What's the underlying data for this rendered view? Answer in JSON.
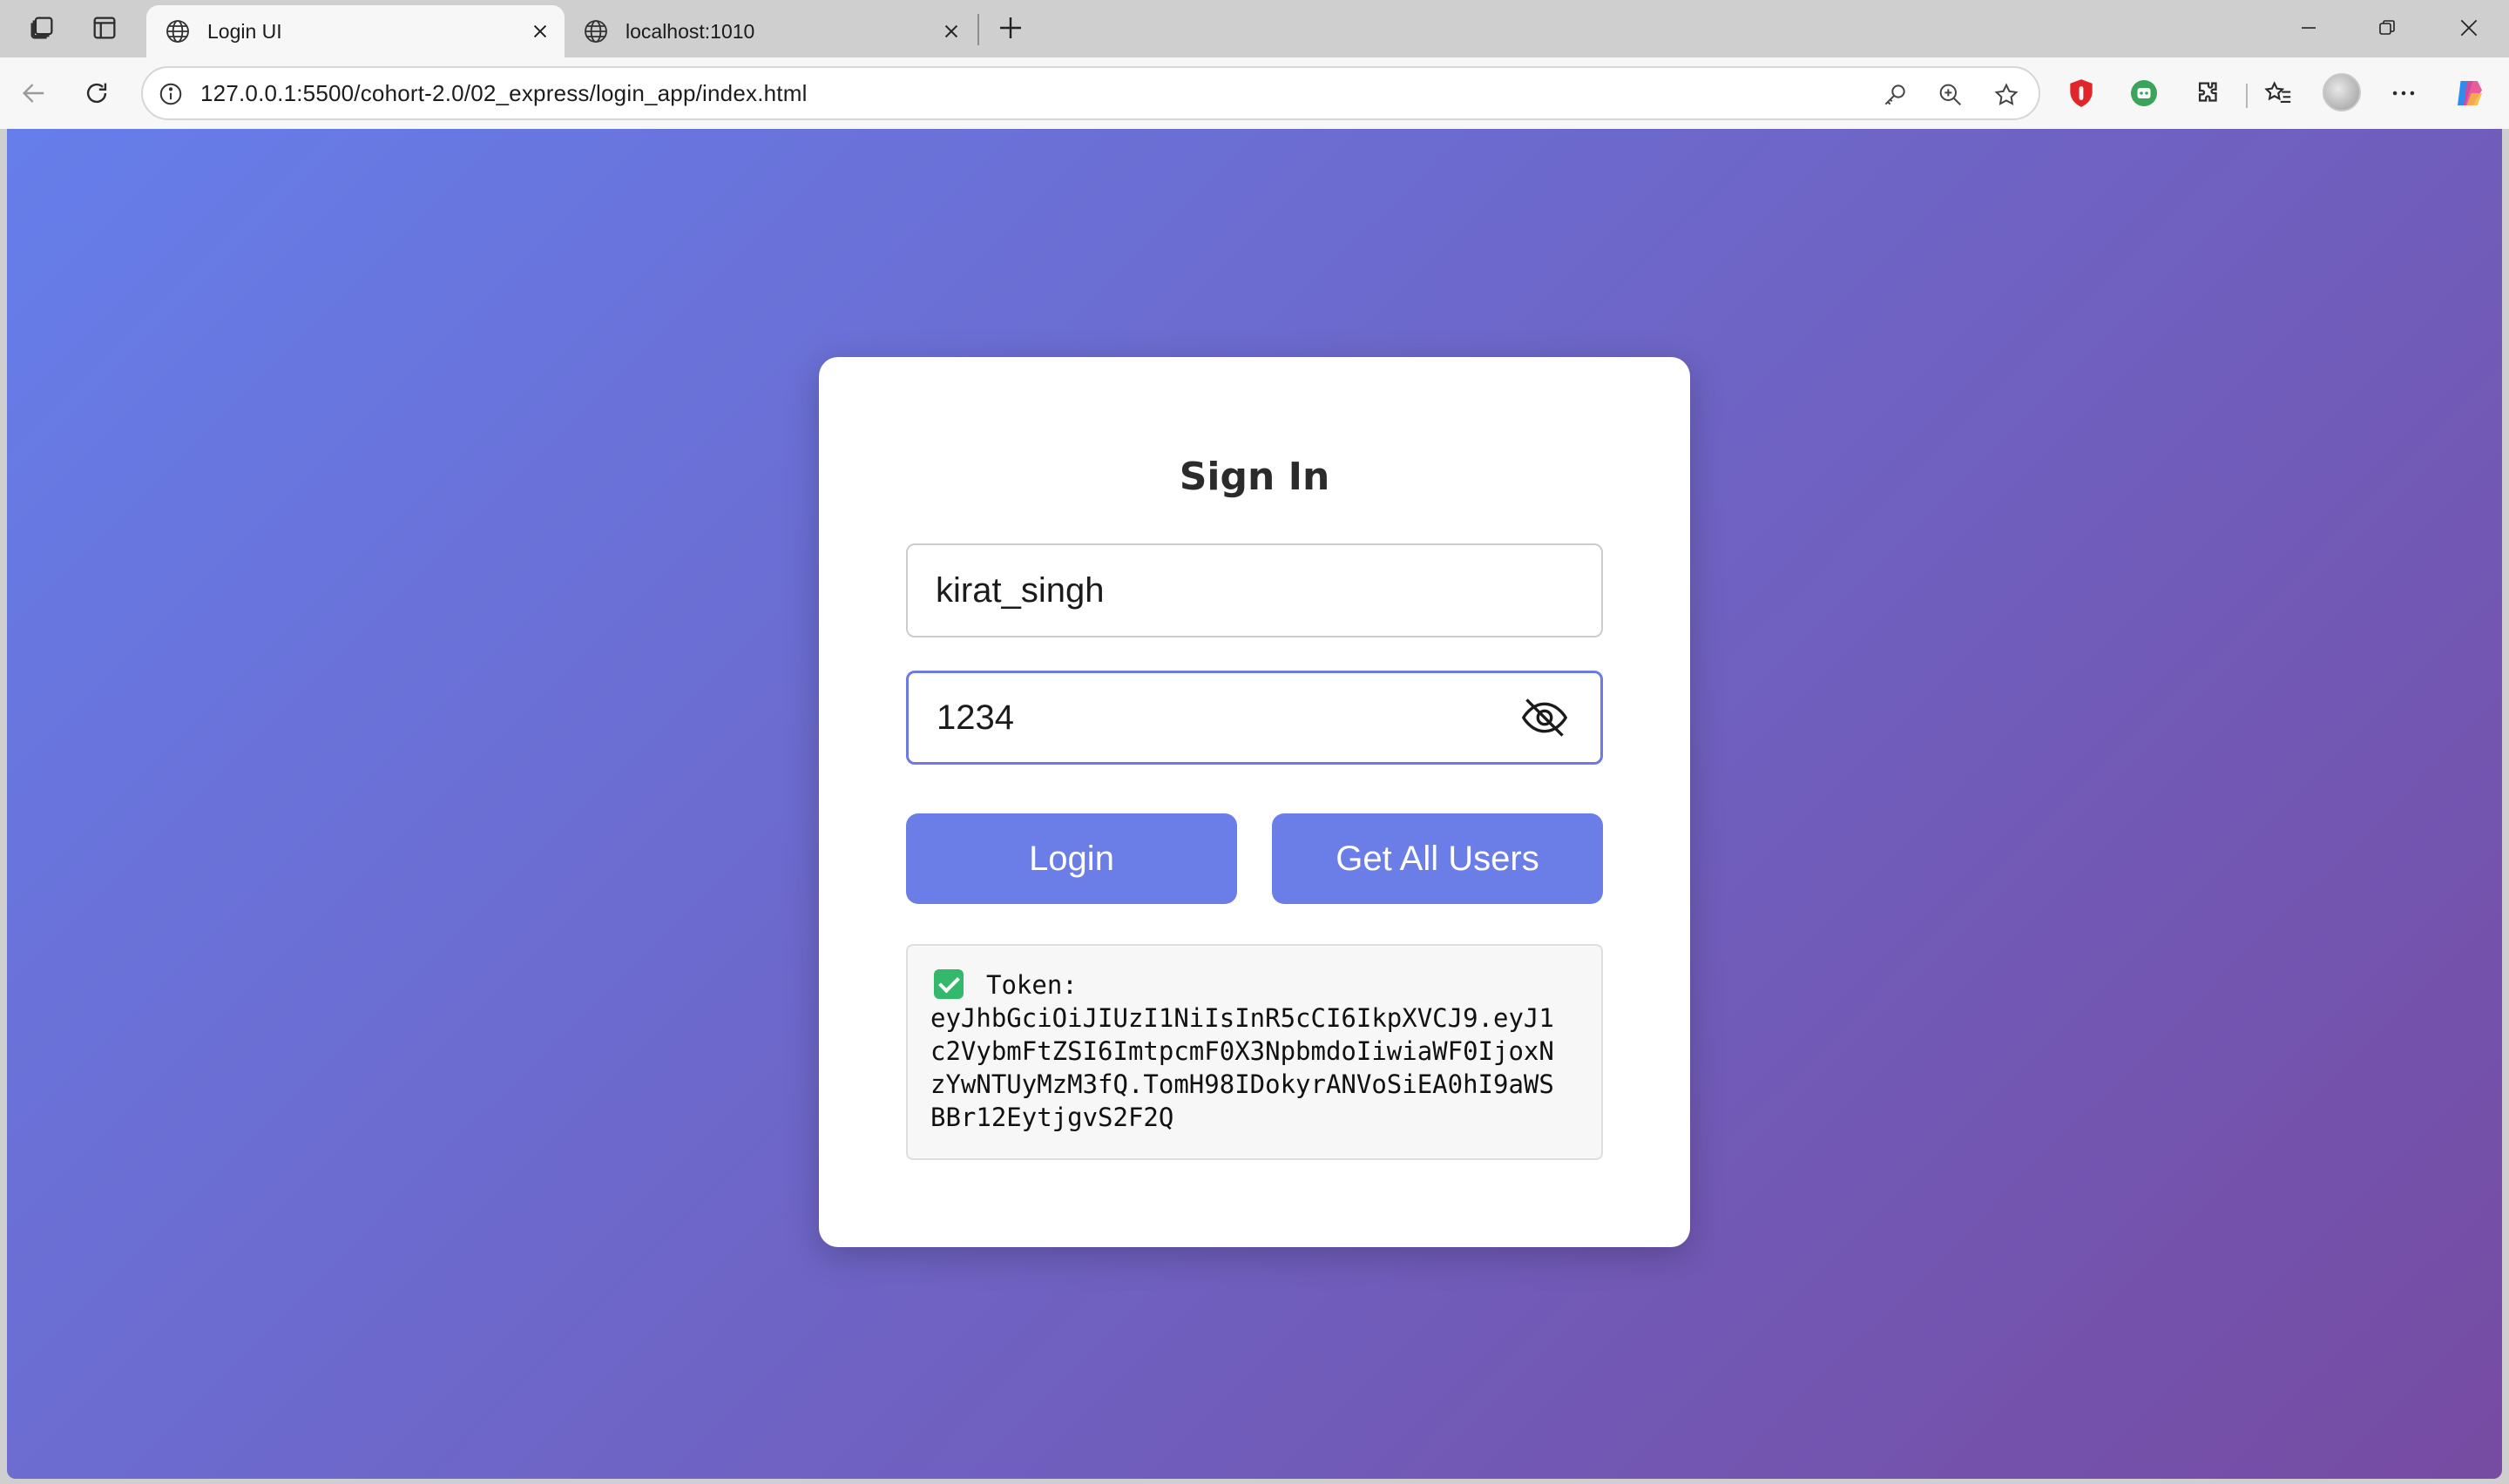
{
  "browser": {
    "tabs": [
      {
        "title": "Login UI",
        "active": true
      },
      {
        "title": "localhost:1010",
        "active": false
      }
    ],
    "address": {
      "url": "127.0.0.1:5500/cohort-2.0/02_express/login_app/index.html"
    },
    "icons": {
      "workspaces": "workspaces-icon",
      "tab_actions": "vertical-tabs-icon",
      "back": "back-arrow-icon",
      "refresh": "refresh-icon",
      "site_info": "info-icon",
      "password": "key-icon",
      "zoom": "zoom-icon",
      "favorite": "star-icon",
      "extensions": "puzzle-icon",
      "favorites": "favorites-icon",
      "menu": "more-icon",
      "copilot": "copilot-icon"
    }
  },
  "page": {
    "gradient": {
      "from": "#667eea",
      "to": "#764ba2"
    },
    "card": {
      "title": "Sign In",
      "username_value": "kirat_singh",
      "password_value": "1234",
      "login_label": "Login",
      "get_users_label": "Get All Users",
      "result": {
        "status_icon": "check-mark-icon",
        "prefix": "Token:",
        "token_lines": [
          "eyJhbGciOiJIUzI1NiIsInR5cCI6IkpXVCJ9.eyJ1",
          "c2VybmFtZSI6ImtpcmF0X3NpbmdoIiwiaWF0IjoxN",
          "zYwNTUyMzM3fQ.TomH98IDokyrANVoSiEA0hI9aWS",
          "BBr12EytjgvS2F2Q"
        ]
      }
    },
    "accent": "#6b7ee8"
  }
}
